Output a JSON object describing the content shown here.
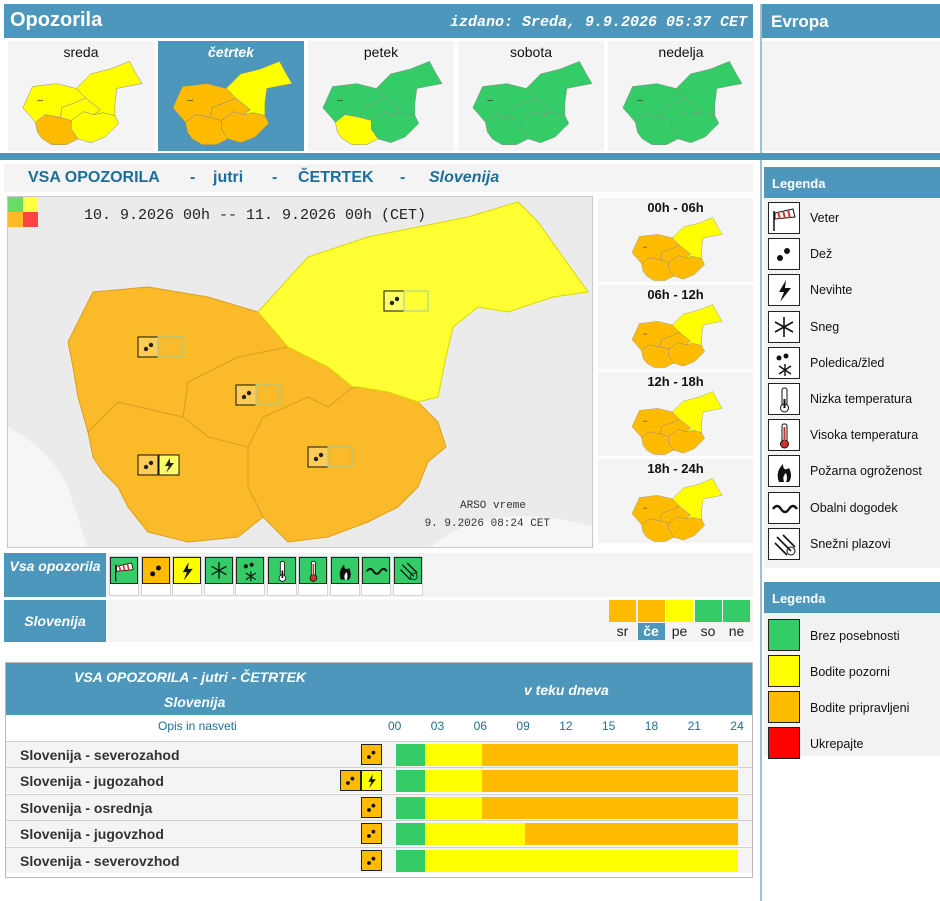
{
  "header": {
    "title": "Opozorila",
    "issued": "izdano: Sreda, 9.9.2026 05:37 CET",
    "europe": "Evropa"
  },
  "days": [
    {
      "label": "sreda",
      "selected": false
    },
    {
      "label": "četrtek",
      "selected": true
    },
    {
      "label": "petek",
      "selected": false
    },
    {
      "label": "sobota",
      "selected": false
    },
    {
      "label": "nedelja",
      "selected": false
    }
  ],
  "subheader": {
    "part1": "VSA OPOZORILA",
    "part2": "jutri",
    "part3": "ČETRTEK",
    "part4": "Slovenija",
    "sep": "-"
  },
  "map": {
    "date_range": "10. 9.2026  00h -- 11. 9.2026  00h   (CET)",
    "credit1": "ARSO vreme",
    "credit2": "9. 9.2026  08:24 CET"
  },
  "periods": [
    {
      "label": "00h - 06h"
    },
    {
      "label": "06h - 12h"
    },
    {
      "label": "12h - 18h"
    },
    {
      "label": "18h - 24h"
    }
  ],
  "legend_icons": {
    "title": "Legenda",
    "items": [
      "Veter",
      "Dež",
      "Nevihte",
      "Sneg",
      "Poledica/žled",
      "Nizka temperatura",
      "Visoka temperatura",
      "Požarna ogroženost",
      "Obalni dogodek",
      "Snežni plazovi"
    ]
  },
  "legend_levels": {
    "title": "Legenda",
    "items": [
      {
        "label": "Brez posebnosti",
        "color": "#33cc66"
      },
      {
        "label": "Bodite pozorni",
        "color": "#ffff00"
      },
      {
        "label": "Bodite pripravljeni",
        "color": "#ffbb00"
      },
      {
        "label": "Ukrepajte",
        "color": "#ff0000"
      }
    ]
  },
  "filters": {
    "all_label": "Vsa opozorila",
    "region_label": "Slovenija",
    "icon_colors": [
      "#33cc66",
      "#ffbb00",
      "#ffff00",
      "#33cc66",
      "#33cc66",
      "#33cc66",
      "#33cc66",
      "#33cc66",
      "#33cc66",
      "#33cc66"
    ]
  },
  "days_strip": [
    {
      "label": "sr",
      "color": "#ffbb00",
      "selected": false
    },
    {
      "label": "če",
      "color": "#ffbb00",
      "selected": true
    },
    {
      "label": "pe",
      "color": "#ffff00",
      "selected": false
    },
    {
      "label": "so",
      "color": "#33cc66",
      "selected": false
    },
    {
      "label": "ne",
      "color": "#33cc66",
      "selected": false
    }
  ],
  "table": {
    "title": "VSA OPOZORILA - jutri - ČETRTEK",
    "subtitle": "Slovenija",
    "during_day": "v teku dneva",
    "desc_link": "Opis in nasveti",
    "hours": [
      "00",
      "03",
      "06",
      "09",
      "12",
      "15",
      "18",
      "21",
      "24"
    ],
    "rows": [
      {
        "name": "Slovenija - severozahod",
        "icons": [
          "dez"
        ],
        "levels": [
          "g",
          "y",
          "o",
          "o",
          "o",
          "o",
          "o",
          "o"
        ]
      },
      {
        "name": "Slovenija - jugozahod",
        "icons": [
          "dez",
          "nevihte"
        ],
        "levels": [
          "g",
          "y",
          "o",
          "o",
          "o",
          "o",
          "o",
          "o"
        ]
      },
      {
        "name": "Slovenija - osrednja",
        "icons": [
          "dez"
        ],
        "levels": [
          "g",
          "y",
          "o",
          "o",
          "o",
          "o",
          "o",
          "o"
        ]
      },
      {
        "name": "Slovenija - jugovzhod",
        "icons": [
          "dez"
        ],
        "levels": [
          "g",
          "y",
          "y",
          "o",
          "o",
          "o",
          "o",
          "o"
        ]
      },
      {
        "name": "Slovenija - severovzhod",
        "icons": [
          "dez"
        ],
        "levels": [
          "g",
          "y",
          "y",
          "y",
          "y",
          "y",
          "y",
          "y"
        ]
      }
    ]
  }
}
